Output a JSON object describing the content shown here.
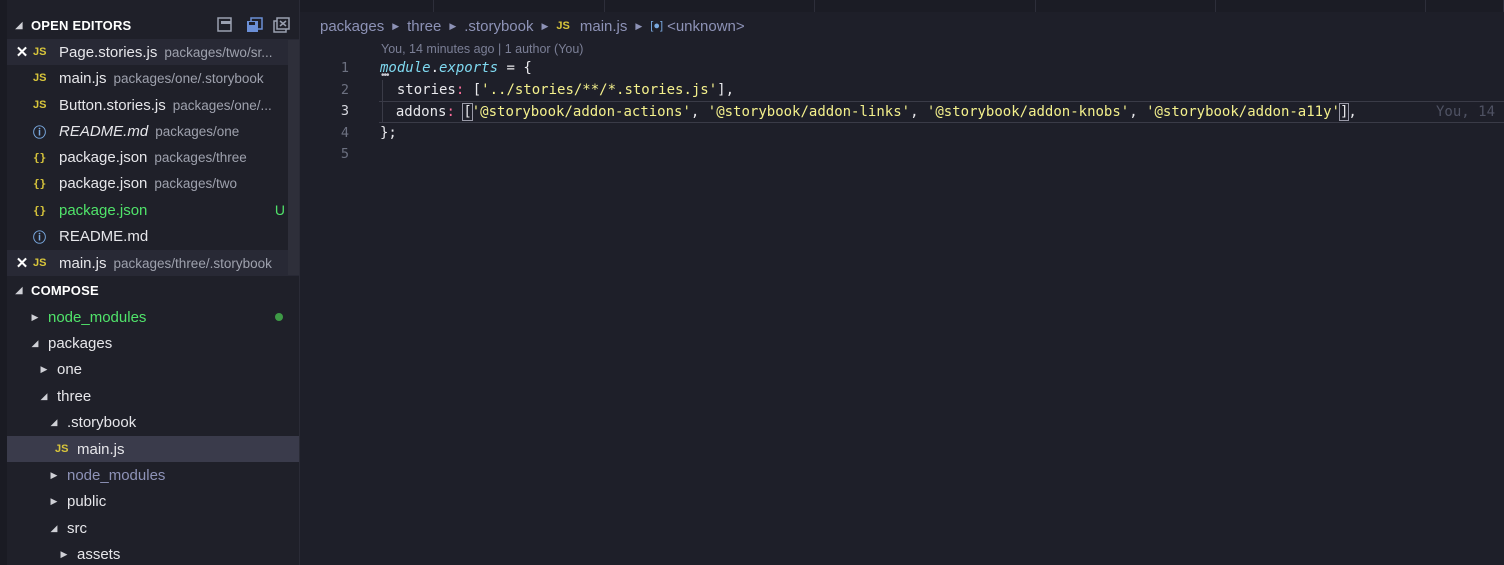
{
  "sidebar": {
    "open_editors": {
      "title": "OPEN EDITORS",
      "items": [
        {
          "name": "Page.stories.js",
          "path": "packages/two/sr...",
          "icon": "js-icon",
          "type": "JS",
          "close": "✕"
        },
        {
          "name": "main.js",
          "path": "packages/one/.storybook",
          "icon": "js-icon",
          "type": "JS"
        },
        {
          "name": "Button.stories.js",
          "path": "packages/one/...",
          "icon": "js-icon",
          "type": "JS"
        },
        {
          "name": "README.md",
          "path": "packages/one",
          "icon": "info-icon",
          "type": "ⓘ"
        },
        {
          "name": "package.json",
          "path": "packages/three",
          "icon": "json-icon",
          "type": "{}"
        },
        {
          "name": "package.json",
          "path": "packages/two",
          "icon": "json-icon",
          "type": "{}"
        },
        {
          "name": "package.json",
          "path": "",
          "icon": "json-icon",
          "type": "{}",
          "badge": "U"
        },
        {
          "name": "README.md",
          "path": "",
          "icon": "info-icon",
          "type": "ⓘ"
        },
        {
          "name": "main.js",
          "path": "packages/three/.storybook",
          "icon": "js-icon",
          "type": "JS",
          "close": "✕"
        }
      ]
    },
    "compose": {
      "title": "COMPOSE",
      "tree": [
        {
          "label": "node_modules"
        },
        {
          "label": "packages"
        },
        {
          "label": "one"
        },
        {
          "label": "three"
        },
        {
          "label": ".storybook"
        },
        {
          "label": "main.js",
          "type": "JS"
        },
        {
          "label": "node_modules"
        },
        {
          "label": "public"
        },
        {
          "label": "src"
        },
        {
          "label": "assets"
        }
      ]
    }
  },
  "editor": {
    "breadcrumb": [
      "packages",
      "three",
      ".storybook",
      "main.js",
      "<unknown>"
    ],
    "breadcrumb_js": "JS",
    "breadcrumb_symbol": "[●]",
    "codelens": "You, 14 minutes ago | 1 author (You)",
    "line_numbers": [
      "1",
      "2",
      "3",
      "4",
      "5"
    ],
    "code": {
      "l1_a": "module",
      "l1_b": ".",
      "l1_c": "exports",
      "l1_d": " = {",
      "l2_key": "  stories",
      "l2_colon": ":",
      "l2_open": " [",
      "l2_str": "'../stories/**/*.stories.js'",
      "l2_close": "],",
      "l3_key": "  addons",
      "l3_colon": ":",
      "l3_open": "[",
      "l3_s1": "'@storybook/addon-actions'",
      "l3_s2": "'@storybook/addon-links'",
      "l3_s3": "'@storybook/addon-knobs'",
      "l3_s4": "'@storybook/addon-a11y'",
      "l3_sep": ", ",
      "l3_close": "]",
      "l3_end": ",",
      "l3_blame": "You, 14",
      "l4": "};"
    }
  },
  "colors": {
    "accent_green": "#50e36a",
    "js_yellow": "#d9c63b",
    "string": "#f4f08c",
    "operator": "#ff6e9c",
    "keyword": "#7fd9f0"
  }
}
